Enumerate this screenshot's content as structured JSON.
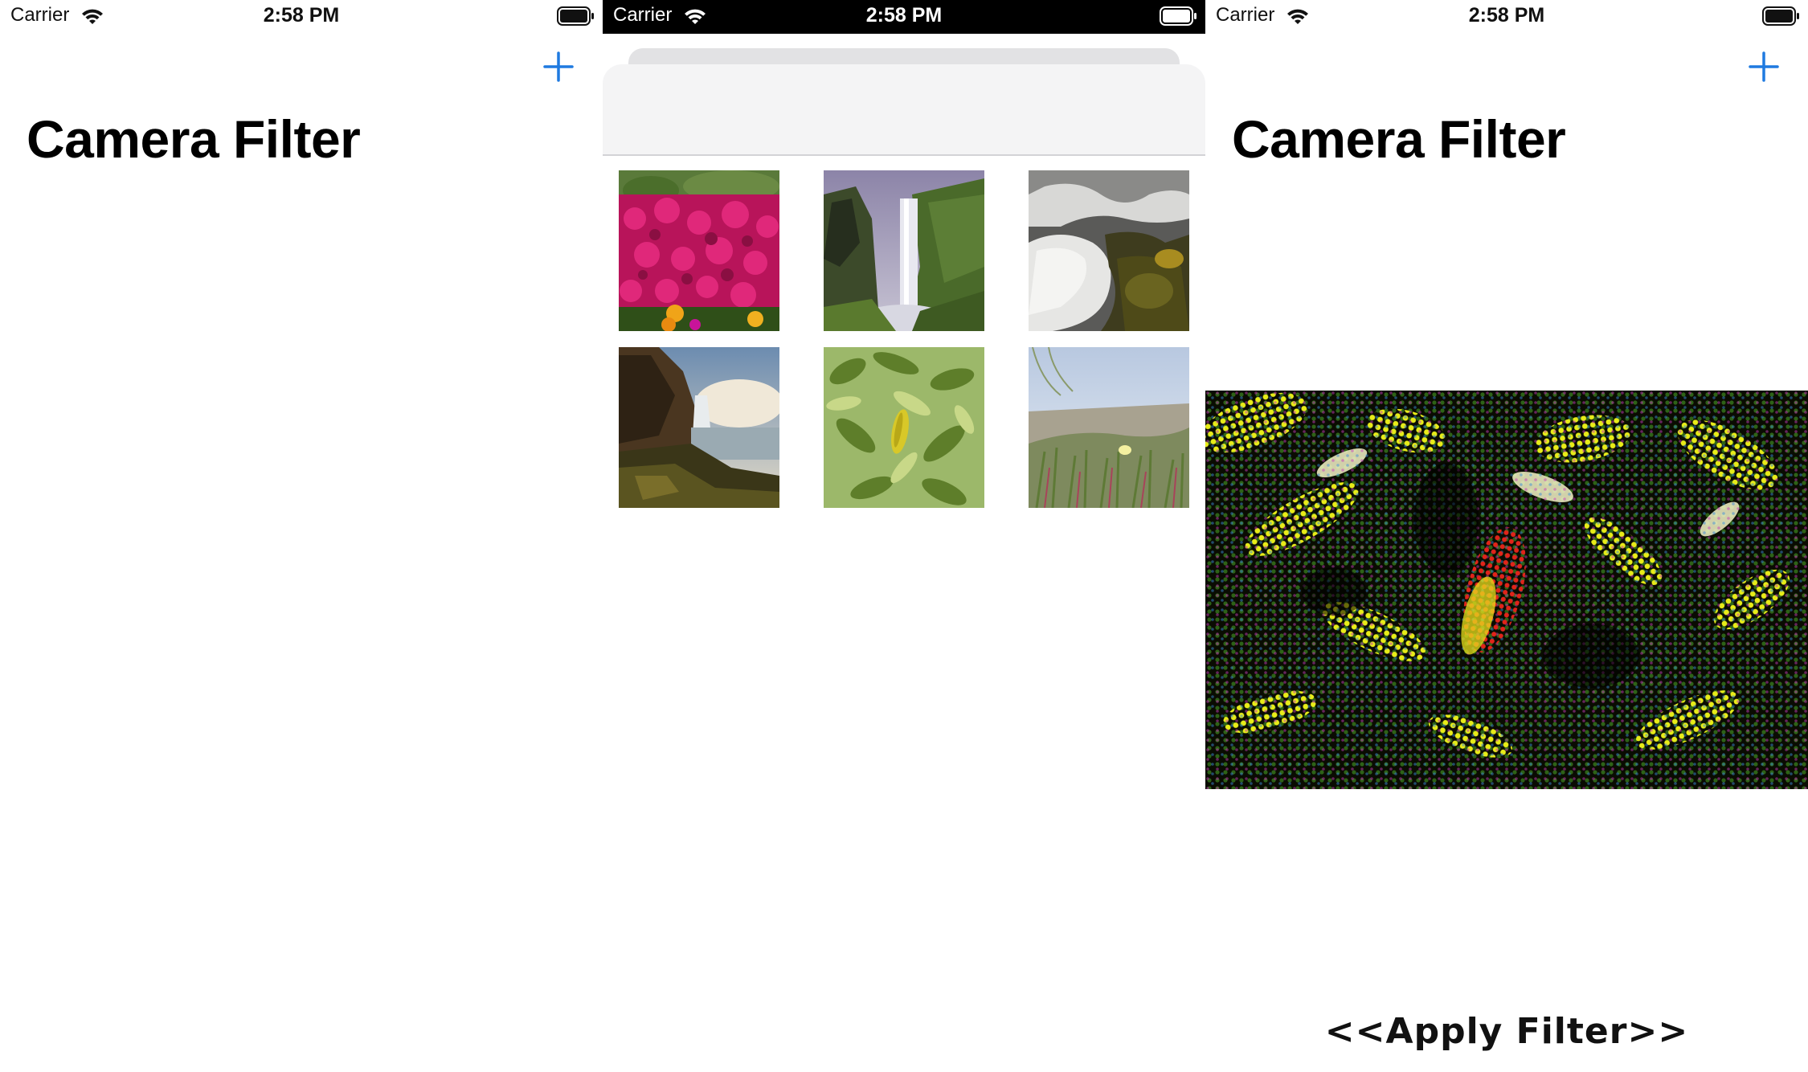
{
  "colors": {
    "tint": "#1f7ae0",
    "status_text_light": "#111111",
    "status_text_dark": "#ffffff",
    "status_bg_dark": "#000000"
  },
  "screens": [
    {
      "status": {
        "carrier": "Carrier",
        "time": "2:58 PM"
      },
      "nav": {
        "title": "Camera Filter",
        "add_icon": "plus-icon"
      }
    },
    {
      "status": {
        "carrier": "Carrier",
        "time": "2:58 PM"
      },
      "picker": {
        "photos": [
          {
            "subject": "flowers"
          },
          {
            "subject": "waterfall"
          },
          {
            "subject": "rapids"
          },
          {
            "subject": "cliff-waterfall"
          },
          {
            "subject": "leaves"
          },
          {
            "subject": "grass"
          }
        ]
      }
    },
    {
      "status": {
        "carrier": "Carrier",
        "time": "2:58 PM"
      },
      "nav": {
        "title": "Camera Filter",
        "add_icon": "plus-icon"
      },
      "filtered_image": {
        "effect": "halftone"
      },
      "apply_button": "<<Apply Filter>>"
    }
  ]
}
